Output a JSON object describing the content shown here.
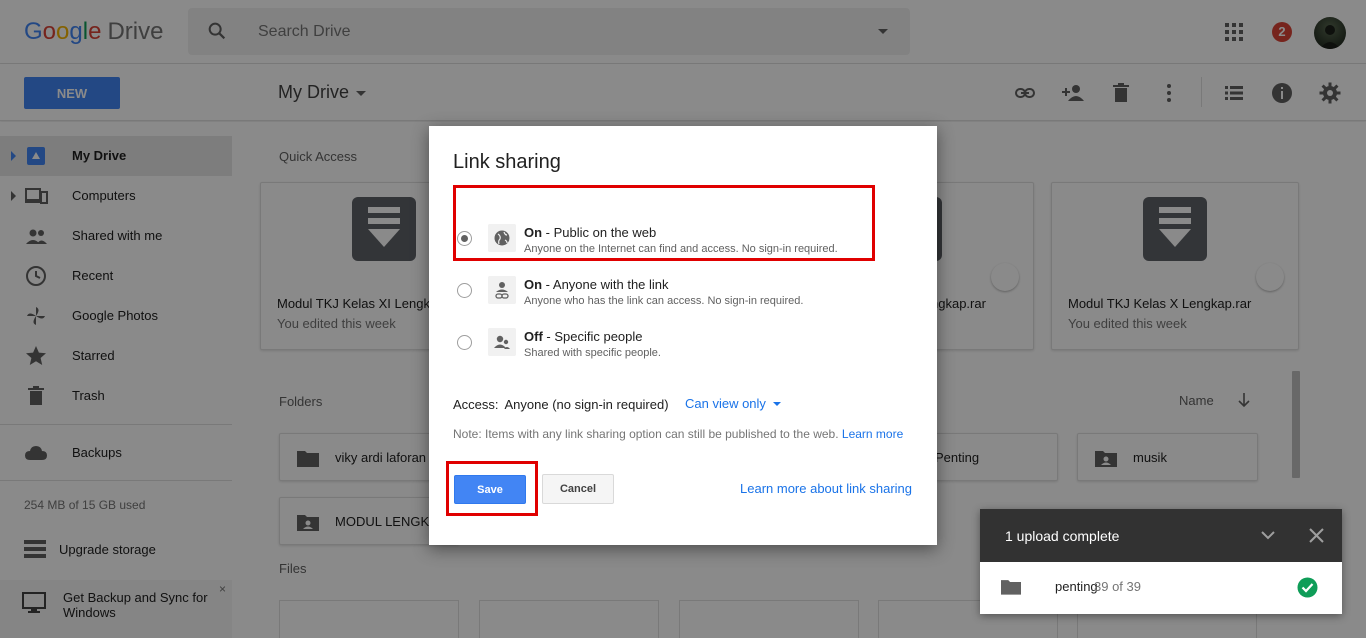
{
  "header": {
    "logo_google": "Google",
    "logo_drive": "Drive",
    "search_placeholder": "Search Drive",
    "notification_count": "2",
    "icons": [
      "search-icon",
      "apps-icon",
      "notifications-badge",
      "avatar"
    ]
  },
  "toolbar": {
    "new_label": "NEW",
    "location_title": "My Drive",
    "icons": [
      "link-icon",
      "add-person-icon",
      "trash-icon",
      "more-vert-icon",
      "list-view-icon",
      "info-icon",
      "settings-icon"
    ]
  },
  "sidebar": {
    "items": [
      {
        "label": "My Drive",
        "icon": "my-drive-icon",
        "active": true
      },
      {
        "label": "Computers",
        "icon": "computers-icon"
      },
      {
        "label": "Shared with me",
        "icon": "shared-icon"
      },
      {
        "label": "Recent",
        "icon": "clock-icon"
      },
      {
        "label": "Google Photos",
        "icon": "photos-icon"
      },
      {
        "label": "Starred",
        "icon": "star-icon"
      },
      {
        "label": "Trash",
        "icon": "trash-icon"
      },
      {
        "label": "Backups",
        "icon": "cloud-icon"
      }
    ],
    "storage": "254 MB of 15 GB used",
    "upgrade_label": "Upgrade storage",
    "backup_promo": "Get Backup and Sync for Windows",
    "close_glyph": "×"
  },
  "main": {
    "quick_access_label": "Quick Access",
    "quick_cards": [
      {
        "name": "Modul TKJ Kelas XI Lengkap.rar",
        "sub": "You edited this week"
      },
      {
        "name": "ngkap.rar",
        "sub": ""
      },
      {
        "name": "Modul TKJ Kelas X Lengkap.rar",
        "sub": "You edited this week"
      }
    ],
    "folders_label": "Folders",
    "sort_label": "Name",
    "folders": [
      {
        "name": "viky ardi laforan"
      },
      {
        "name": "Penting"
      },
      {
        "name": "musik"
      },
      {
        "name": "MODUL LENGKA"
      }
    ],
    "files_label": "Files"
  },
  "dialog": {
    "title": "Link sharing",
    "options": [
      {
        "title_bold": "On",
        "title_rest": " - Public on the web",
        "desc": "Anyone on the Internet can find and access. No sign-in required.",
        "icon": "globe-icon",
        "selected": true
      },
      {
        "title_bold": "On",
        "title_rest": " - Anyone with the link",
        "desc": "Anyone who has the link can access. No sign-in required.",
        "icon": "link-person-icon",
        "selected": false
      },
      {
        "title_bold": "Off",
        "title_rest": " - Specific people",
        "desc": "Shared with specific people.",
        "icon": "people-icon",
        "selected": false
      }
    ],
    "access_label": "Access:",
    "access_value": "Anyone (no sign-in required)",
    "access_level": "Can view only",
    "note_text": "Note: Items with any link sharing option can still be published to the web.",
    "note_link": "Learn more",
    "save_label": "Save",
    "cancel_label": "Cancel",
    "learn_more_link": "Learn more about link sharing"
  },
  "upload_panel": {
    "title": "1 upload complete",
    "file_name": "penting",
    "file_count": "39 of 39"
  },
  "colors": {
    "accent": "#4285f4",
    "link": "#1a73e8",
    "highlight": "#e00000",
    "success": "#0f9d58",
    "badge": "#db4437"
  }
}
